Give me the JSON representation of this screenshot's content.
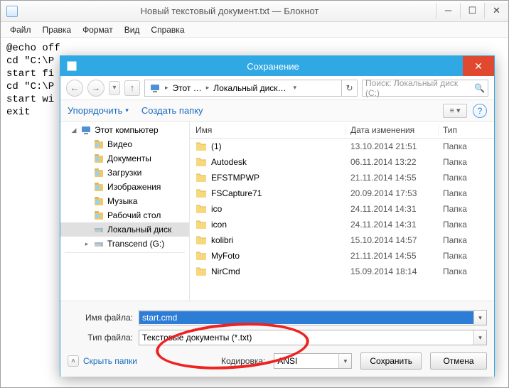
{
  "notepad": {
    "title": "Новый текстовый документ.txt — Блокнот",
    "menu": [
      "Файл",
      "Правка",
      "Формат",
      "Вид",
      "Справка"
    ],
    "body": "@echo off\ncd \"C:\\P\nstart fi\ncd \"C:\\P\nstart wi\nexit"
  },
  "dialog": {
    "title": "Сохранение",
    "breadcrumb": {
      "root": "Этот …",
      "path": "Локальный диск…"
    },
    "search_placeholder": "Поиск: Локальный диск (C:)",
    "toolbar": {
      "organize": "Упорядочить",
      "newfolder": "Создать папку"
    },
    "tree": [
      {
        "type": "root",
        "label": "Этот компьютер",
        "icon": "pc"
      },
      {
        "type": "sub",
        "label": "Видео",
        "icon": "lib"
      },
      {
        "type": "sub",
        "label": "Документы",
        "icon": "lib"
      },
      {
        "type": "sub",
        "label": "Загрузки",
        "icon": "lib"
      },
      {
        "type": "sub",
        "label": "Изображения",
        "icon": "lib"
      },
      {
        "type": "sub",
        "label": "Музыка",
        "icon": "lib"
      },
      {
        "type": "sub",
        "label": "Рабочий стол",
        "icon": "lib"
      },
      {
        "type": "sub",
        "label": "Локальный диск",
        "icon": "drive",
        "sel": true
      },
      {
        "type": "sub",
        "label": "Transcend (G:)",
        "icon": "drive",
        "tog": "▸"
      }
    ],
    "columns": {
      "name": "Имя",
      "date": "Дата изменения",
      "type": "Тип"
    },
    "files": [
      {
        "name": "(1)",
        "date": "13.10.2014 21:51",
        "type": "Папка"
      },
      {
        "name": "Autodesk",
        "date": "06.11.2014 13:22",
        "type": "Папка"
      },
      {
        "name": "EFSTMPWP",
        "date": "21.11.2014 14:55",
        "type": "Папка"
      },
      {
        "name": "FSCapture71",
        "date": "20.09.2014 17:53",
        "type": "Папка"
      },
      {
        "name": "ico",
        "date": "24.11.2014 14:31",
        "type": "Папка"
      },
      {
        "name": "icon",
        "date": "24.11.2014 14:31",
        "type": "Папка"
      },
      {
        "name": "kolibri",
        "date": "15.10.2014 14:57",
        "type": "Папка"
      },
      {
        "name": "MyFoto",
        "date": "21.11.2014 14:55",
        "type": "Папка"
      },
      {
        "name": "NirCmd",
        "date": "15.09.2014 18:14",
        "type": "Папка"
      }
    ],
    "filename_label": "Имя файла:",
    "filename_value": "start.cmd",
    "filetype_label": "Тип файла:",
    "filetype_value": "Текстовые документы (*.txt)",
    "hide_folders": "Скрыть папки",
    "encoding_label": "Кодировка:",
    "encoding_value": "ANSI",
    "save": "Сохранить",
    "cancel": "Отмена"
  }
}
